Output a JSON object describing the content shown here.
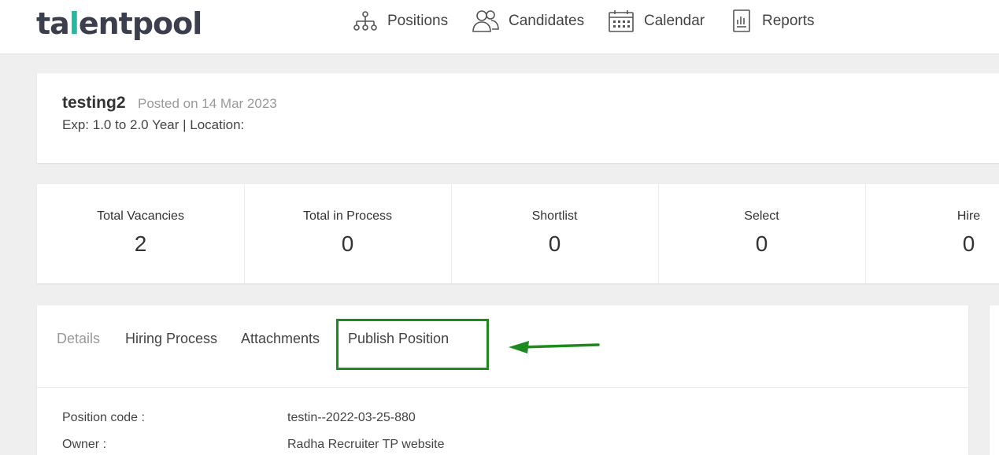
{
  "brand": {
    "logo_pre": "ta",
    "logo_accent": "l",
    "logo_post": "entpool"
  },
  "nav": [
    {
      "label": "Positions",
      "icon": "org-chart-icon"
    },
    {
      "label": "Candidates",
      "icon": "users-icon"
    },
    {
      "label": "Calendar",
      "icon": "calendar-icon"
    },
    {
      "label": "Reports",
      "icon": "report-icon"
    }
  ],
  "job": {
    "title": "testing2",
    "posted": "Posted on 14 Mar 2023",
    "meta": "Exp: 1.0 to 2.0 Year | Location:"
  },
  "stats": [
    {
      "label": "Total Vacancies",
      "value": "2"
    },
    {
      "label": "Total in Process",
      "value": "0"
    },
    {
      "label": "Shortlist",
      "value": "0"
    },
    {
      "label": "Select",
      "value": "0"
    },
    {
      "label": "Hire",
      "value": "0"
    }
  ],
  "tabs": [
    {
      "label": "Details"
    },
    {
      "label": "Hiring Process"
    },
    {
      "label": "Attachments"
    },
    {
      "label": "Publish Position"
    }
  ],
  "details": [
    {
      "label": "Position code :",
      "value": "testin--2022-03-25-880"
    },
    {
      "label": "Owner :",
      "value": "Radha Recruiter TP website"
    }
  ],
  "colors": {
    "accent": "#26b7a0",
    "highlight": "#1d8a1d"
  }
}
